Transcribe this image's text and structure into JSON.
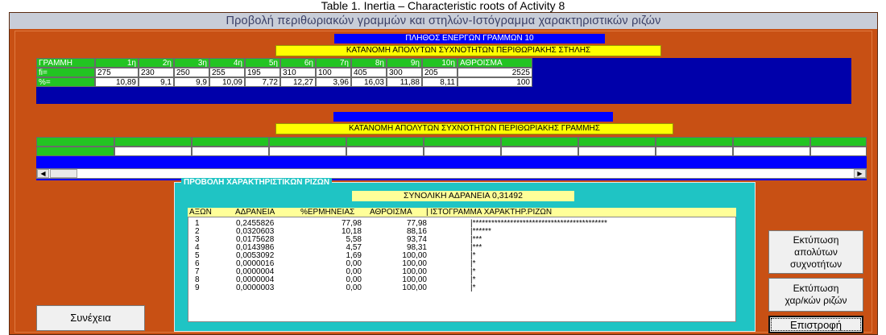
{
  "caption": "Table 1. Inertia – Characteristic roots of Activity 8",
  "window_title": "Προβολή περιθωριακών γραμμών και στηλών-Ιστόγραμμα χαρακτηριστικών ριζών",
  "active_rows_label": "ΠΛΗΘΟΣ ΕΝΕΡΓΩΝ ΓΡΑΜΜΩΝ 10",
  "column_marginal_label": "ΚΑΤΑΝΟΜΗ ΑΠΟΛΥΤΩΝ ΣΥΧΝΟΤΗΤΩΝ ΠΕΡΙΘΩΡΙΑΚΗΣ ΣΤΗΛΗΣ",
  "row_marginal_label": "ΚΑΤΑΝΟΜΗ ΑΠΟΛΥΤΩΝ ΣΥΧΝΟΤΗΤΩΝ ΠΕΡΙΘΩΡΙΑΚΗΣ ΓΡΑΜΜΗΣ",
  "column_table": {
    "corner": "ΓΡΑΜΜΗ",
    "headers": [
      "1η",
      "2η",
      "3η",
      "4η",
      "5η",
      "6η",
      "7η",
      "8η",
      "9η",
      "10η",
      "ΑΘΡΟΙΣΜΑ"
    ],
    "rows": [
      {
        "label": "fi=",
        "values": [
          "275",
          "230",
          "250",
          "255",
          "195",
          "310",
          "100",
          "405",
          "300",
          "205",
          "2525"
        ]
      },
      {
        "label": "%=",
        "values": [
          "10,89",
          "9,1",
          "9,9",
          "10,09",
          "7,72",
          "12,27",
          "3,96",
          "16,03",
          "11,88",
          "8,11",
          "100"
        ]
      }
    ]
  },
  "roots_frame_title": "ΠΡΟΒΟΛΗ ΧΑΡΑΚΤΗΡΙΣΤΙΚΩΝ ΡΙΖΩΝ",
  "total_inertia": "ΣΥΝΟΛΙΚΗ ΑΔΡΑΝΕΙΑ 0,31492",
  "roots_header": {
    "axis": "ΑΞΩΝ",
    "inertia": "ΑΔΡΑΝΕΙΑ",
    "explained": "%ΕΡΜΗΝΕΙΑΣ",
    "cumulative": "ΑΘΡΟΙΣΜΑ",
    "histogram": "| ΙΣΤΟΓΡΑΜΜΑ ΧΑΡΑΚΤΗΡ.ΡΙΖΩΝ"
  },
  "roots": [
    {
      "axis": "1",
      "inertia": "0,2455826",
      "explained": "77,98",
      "cumulative": "77,98",
      "hist": "|*******************************************"
    },
    {
      "axis": "2",
      "inertia": "0,0320603",
      "explained": "10,18",
      "cumulative": "88,16",
      "hist": "|******"
    },
    {
      "axis": "3",
      "inertia": "0,0175628",
      "explained": "5,58",
      "cumulative": "93,74",
      "hist": "|***"
    },
    {
      "axis": "4",
      "inertia": "0,0143986",
      "explained": "4,57",
      "cumulative": "98,31",
      "hist": "|***"
    },
    {
      "axis": "5",
      "inertia": "0,0053092",
      "explained": "1,69",
      "cumulative": "100,00",
      "hist": "|*"
    },
    {
      "axis": "6",
      "inertia": "0,0000016",
      "explained": "0,00",
      "cumulative": "100,00",
      "hist": "|*"
    },
    {
      "axis": "7",
      "inertia": "0,0000004",
      "explained": "0,00",
      "cumulative": "100,00",
      "hist": "|*"
    },
    {
      "axis": "8",
      "inertia": "0,0000004",
      "explained": "0,00",
      "cumulative": "100,00",
      "hist": "|*"
    },
    {
      "axis": "9",
      "inertia": "0,0000003",
      "explained": "0,00",
      "cumulative": "100,00",
      "hist": "|*"
    }
  ],
  "buttons": {
    "continue": "Συνέχεια",
    "print_abs_freq": [
      "Εκτύπωση",
      "απολύτων",
      "συχνοτήτων"
    ],
    "print_roots": [
      "Εκτύπωση",
      "χαρ/κών ριζών"
    ],
    "back": "Επιστροφή"
  },
  "colors": {
    "background": "#c85014",
    "grid_header": "#22c422",
    "grid_panel": "#0000aa",
    "banner_blue": "#0000ff",
    "banner_yellow": "#ffff00",
    "roots_frame": "#1fc4c4"
  }
}
